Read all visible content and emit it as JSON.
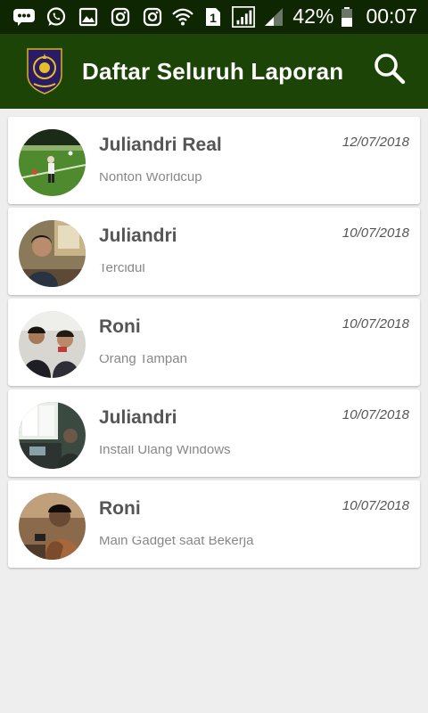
{
  "status_bar": {
    "battery_percent": "42%",
    "time": "00:07",
    "sim_slot": "1",
    "icons": [
      "bbm-icon",
      "whatsapp-icon",
      "gallery-icon",
      "instagram-icon",
      "instagram-icon",
      "wifi-icon",
      "sim-icon",
      "signal-icon",
      "signal-weak-icon",
      "battery-icon"
    ]
  },
  "app_bar": {
    "title": "Daftar Seluruh Laporan",
    "logo_icon": "police-emblem-icon",
    "search_icon": "search-icon"
  },
  "reports": [
    {
      "name": "Juliandri Real",
      "date": "12/07/2018",
      "description": "Nonton Worldcup",
      "avatar": "football-field-photo"
    },
    {
      "name": "Juliandri",
      "date": "10/07/2018",
      "description": "Tercidul",
      "avatar": "person-office-photo"
    },
    {
      "name": "Roni",
      "date": "10/07/2018",
      "description": "Orang Tampan",
      "avatar": "two-people-photo"
    },
    {
      "name": "Juliandri",
      "date": "10/07/2018",
      "description": "Install Ulang Windows",
      "avatar": "room-window-photo"
    },
    {
      "name": "Roni",
      "date": "10/07/2018",
      "description": "Main Gadget saat Bekerja",
      "avatar": "person-phone-photo"
    }
  ],
  "colors": {
    "status_bar": "#0f2603",
    "app_bar": "#1c4406",
    "background": "#eeeeee",
    "card": "#ffffff",
    "text": "#555555"
  }
}
